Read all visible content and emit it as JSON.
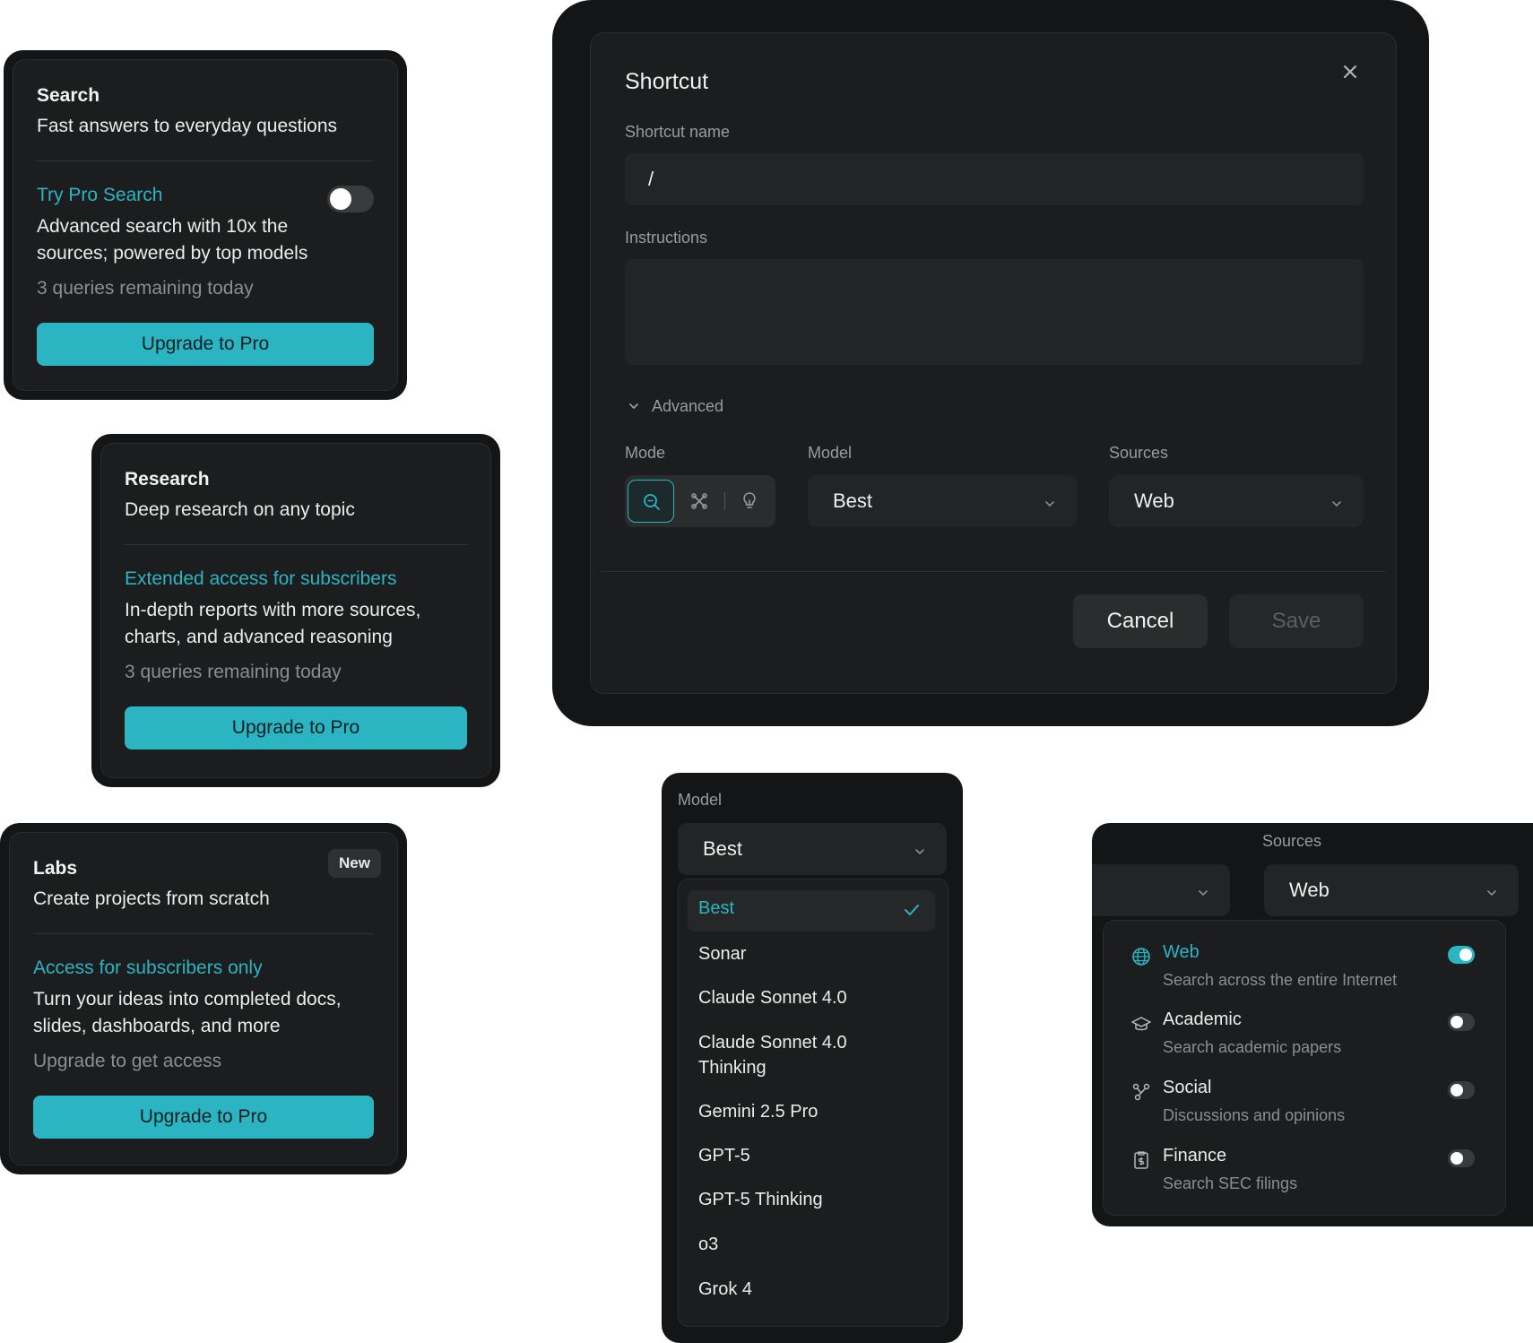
{
  "search_card": {
    "title": "Search",
    "subtitle": "Fast answers to everyday questions",
    "accent": "Try Pro Search",
    "body_line1": "Advanced search with 10x the",
    "body_line2": "sources; powered by top models",
    "remaining": "3 queries remaining today",
    "button": "Upgrade to Pro",
    "toggle_on": false
  },
  "research_card": {
    "title": "Research",
    "subtitle": "Deep research on any topic",
    "accent": "Extended access for subscribers",
    "body_line1": "In-depth reports with more sources,",
    "body_line2": "charts, and advanced reasoning",
    "remaining": "3 queries remaining today",
    "button": "Upgrade to Pro"
  },
  "labs_card": {
    "title": "Labs",
    "badge": "New",
    "subtitle": "Create projects from scratch",
    "accent": "Access for subscribers only",
    "body_line1": "Turn your ideas into completed docs,",
    "body_line2": "slides, dashboards, and more",
    "remaining": "Upgrade to get access",
    "button": "Upgrade to Pro"
  },
  "shortcut_modal": {
    "title": "Shortcut",
    "name_label": "Shortcut name",
    "name_value": "/",
    "instructions_label": "Instructions",
    "advanced_label": "Advanced",
    "mode_label": "Mode",
    "model_label": "Model",
    "model_value": "Best",
    "sources_label": "Sources",
    "sources_value": "Web",
    "cancel": "Cancel",
    "save": "Save"
  },
  "model_dropdown": {
    "label": "Model",
    "selected": "Best",
    "options": [
      "Best",
      "Sonar",
      "Claude Sonnet 4.0",
      "Claude Sonnet 4.0",
      "Thinking",
      "Gemini 2.5 Pro",
      "GPT-5",
      "GPT-5 Thinking",
      "o3",
      "Grok 4"
    ]
  },
  "sources_panel": {
    "label": "Sources",
    "selected": "Web",
    "items": [
      {
        "name": "Web",
        "desc": "Search across the entire Internet",
        "icon": "globe-icon",
        "on": true
      },
      {
        "name": "Academic",
        "desc": "Search academic papers",
        "icon": "graduation-cap-icon",
        "on": false
      },
      {
        "name": "Social",
        "desc": "Discussions and opinions",
        "icon": "social-network-icon",
        "on": false
      },
      {
        "name": "Finance",
        "desc": "Search SEC filings",
        "icon": "finance-document-icon",
        "on": false
      }
    ]
  },
  "colors": {
    "accent": "#2bb5c3",
    "panel": "#1c1d1e",
    "frame": "#141516"
  }
}
